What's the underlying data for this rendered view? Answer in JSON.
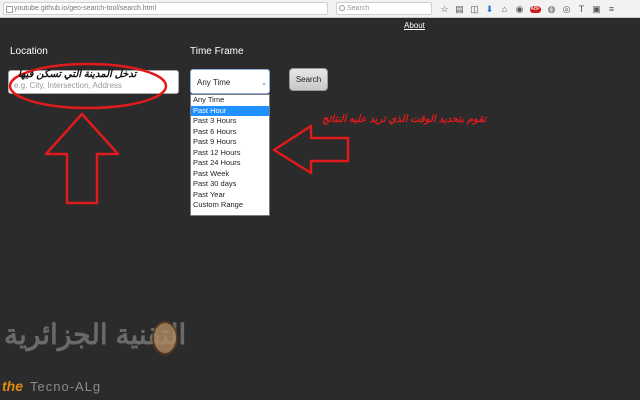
{
  "browser": {
    "url": "youtube.github.io/geo-search-tool/search.html",
    "search_placeholder": "Search",
    "toolbar_icons": [
      "star-icon",
      "clipboard-icon",
      "pocket-icon",
      "download-icon",
      "home-icon",
      "extension-icon",
      "abp-icon",
      "extension-icon",
      "extension-icon",
      "text-icon",
      "extension-icon",
      "menu-icon"
    ],
    "abp_label": "ABP"
  },
  "page": {
    "about_label": "About",
    "location_label": "Location",
    "location_placeholder": "e.g. City, Intersection, Address",
    "timeframe_label": "Time Frame",
    "timeframe_selected": "Any Time",
    "search_button": "Search",
    "timeframe_options": [
      "Any Time",
      "Past Hour",
      "Past 3 Hours",
      "Past 6 Hours",
      "Past 9 Hours",
      "Past 12 Hours",
      "Past 24 Hours",
      "Past Week",
      "Past 30 days",
      "Past Year",
      "Custom Range"
    ],
    "highlighted_option_index": 1
  },
  "annotations": {
    "location_note": "تدخل المدينة التي تسكن فيها",
    "timeframe_note": "تقوم بتحديد الوقت الذي تريد عليه النتائج",
    "color": "#e11b1b"
  },
  "watermark": {
    "arabic": "التقنية الجزائرية",
    "the": "the",
    "english": "Tecno-ALg"
  }
}
